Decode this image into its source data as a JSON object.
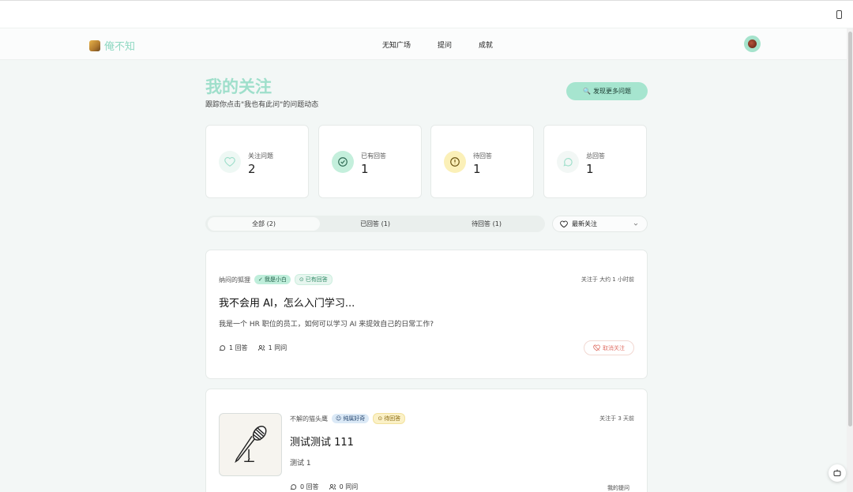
{
  "app": {
    "logo_text": "俺不知"
  },
  "nav": {
    "items": [
      "无知广场",
      "提问",
      "成就"
    ]
  },
  "header": {
    "title": "我的关注",
    "subtitle": "跟踪你点击\"我也有此问\"的问题动态",
    "discover_label": "发现更多问题"
  },
  "stats": [
    {
      "label": "关注问题",
      "value": "2",
      "icon": "heart-icon"
    },
    {
      "label": "已有回答",
      "value": "1",
      "icon": "check-circle-icon"
    },
    {
      "label": "待回答",
      "value": "1",
      "icon": "alert-circle-icon"
    },
    {
      "label": "总回答",
      "value": "1",
      "icon": "chat-bubble-icon"
    }
  ],
  "filter": {
    "tabs": [
      "全部 (2)",
      "已回答 (1)",
      "待回答 (1)"
    ],
    "active_tab": 0,
    "sort_selected": "最新关注"
  },
  "questions": [
    {
      "author": "纳闷的狐狸",
      "level_badge": "我是小白",
      "status_badge": "已有回答",
      "followed_at": "关注于 大约 1 小时前",
      "title": "我不会用 AI，怎么入门学习...",
      "description": "我是一个 HR 职位的员工，如何可以学习 AI 来提效自己的日常工作?",
      "answers": "1 回答",
      "same_question": "1 同问",
      "unfollow_label": "取消关注"
    },
    {
      "author": "不解的猫头鹰",
      "level_badge": "纯属好奇",
      "status_badge": "待回答",
      "followed_at": "关注于 3 天前",
      "title": "测试测试 111",
      "description": "测试 1",
      "answers": "0 回答",
      "same_question": "0 同问",
      "my_question_label": "我的提问"
    }
  ],
  "colors": {
    "accent": "#a6e5cf",
    "title": "#9fdfcb",
    "pending": "#fbf1c7",
    "unfollow": "#e0746a"
  }
}
